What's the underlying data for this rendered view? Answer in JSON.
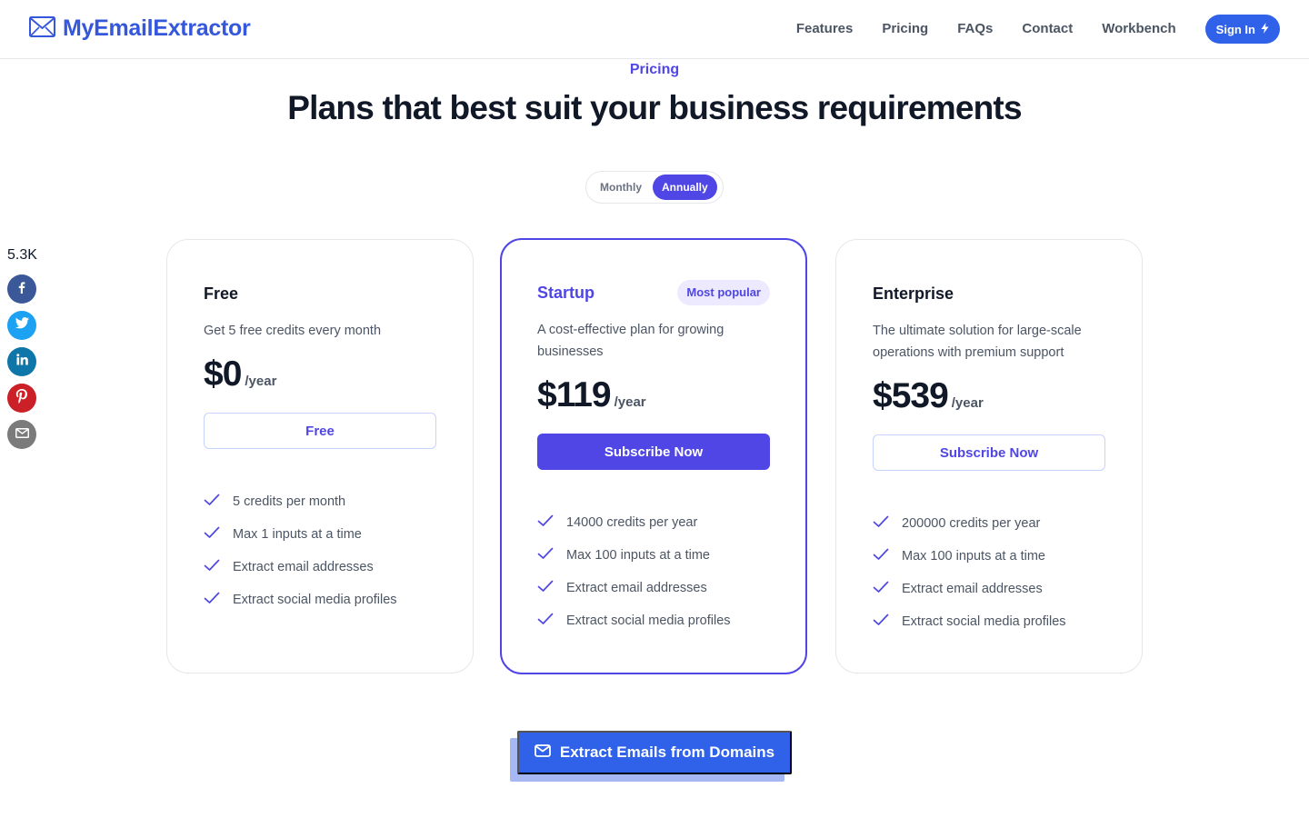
{
  "header": {
    "brand": "MyEmailExtractor",
    "nav": [
      "Features",
      "Pricing",
      "FAQs",
      "Contact",
      "Workbench"
    ],
    "signin_label": "Sign In"
  },
  "hero": {
    "eyebrow": "Pricing",
    "title": "Plans that best suit your business requirements"
  },
  "billing_toggle": {
    "options": [
      "Monthly",
      "Annually"
    ],
    "selected": "Annually"
  },
  "share": {
    "count": "5.3K",
    "networks": [
      "facebook",
      "twitter",
      "linkedin",
      "pinterest",
      "email"
    ]
  },
  "plans": [
    {
      "name": "Free",
      "description": "Get 5 free credits every month",
      "price": "$0",
      "period": "/year",
      "button": "Free",
      "features": [
        "5 credits per month",
        "Max 1 inputs at a time",
        "Extract email addresses",
        "Extract social media profiles"
      ]
    },
    {
      "name": "Startup",
      "badge": "Most popular",
      "description": "A cost-effective plan for growing businesses",
      "price": "$119",
      "period": "/year",
      "button": "Subscribe Now",
      "features": [
        "14000 credits per year",
        "Max 100 inputs at a time",
        "Extract email addresses",
        "Extract social media profiles"
      ]
    },
    {
      "name": "Enterprise",
      "description": "The ultimate solution for large-scale operations with premium support",
      "price": "$539",
      "period": "/year",
      "button": "Subscribe Now",
      "features": [
        "200000 credits per year",
        "Max 100 inputs at a time",
        "Extract email addresses",
        "Extract social media profiles"
      ]
    }
  ],
  "cta": {
    "label": "Extract Emails from Domains"
  },
  "colors": {
    "brand_blue": "#3457dc",
    "accent_indigo": "#4f46e5",
    "cta_blue": "#2f62e8"
  }
}
